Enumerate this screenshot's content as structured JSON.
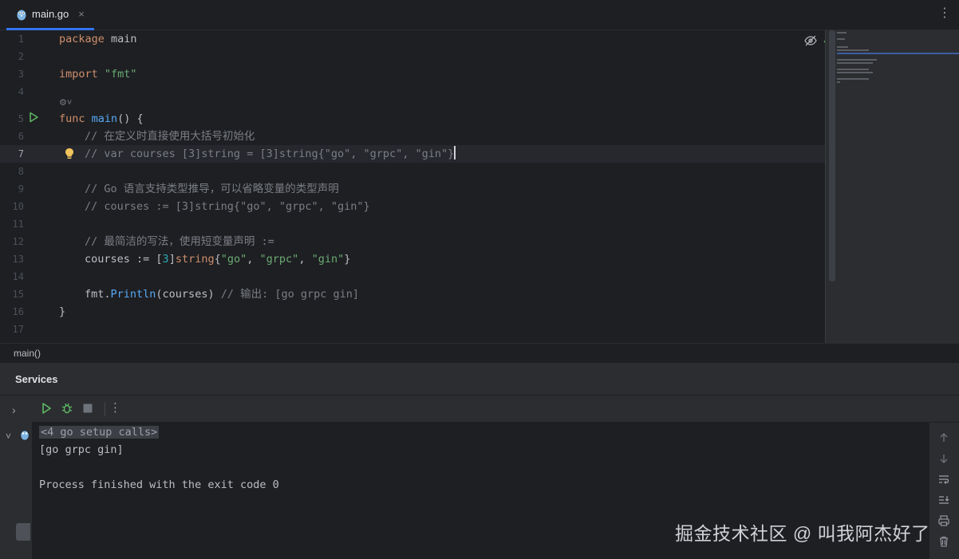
{
  "tab": {
    "label": "main.go",
    "close": "×",
    "more": "⋮"
  },
  "editor": {
    "lines": [
      {
        "n": "1"
      },
      {
        "n": "2"
      },
      {
        "n": "3"
      },
      {
        "n": "4"
      },
      {
        "n": "5"
      },
      {
        "n": "6"
      },
      {
        "n": "7"
      },
      {
        "n": "8"
      },
      {
        "n": "9"
      },
      {
        "n": "10"
      },
      {
        "n": "11"
      },
      {
        "n": "12"
      },
      {
        "n": "13"
      },
      {
        "n": "14"
      },
      {
        "n": "15"
      },
      {
        "n": "16"
      },
      {
        "n": "17"
      }
    ],
    "code": {
      "l1_kw": "package",
      "l1_rest": " main",
      "l3_kw": "import",
      "l3_str": "\"fmt\"",
      "l5_kw": "func",
      "l5_fn": "main",
      "l5_rest": "() {",
      "l6_cm": "// 在定义时直接使用大括号初始化",
      "l7_cm": "// var courses [3]string = [3]string{\"go\", \"grpc\", \"gin\"}",
      "l9_cm": "// Go 语言支持类型推导，可以省略变量的类型声明",
      "l10_cm": "// courses := [3]string{\"go\", \"grpc\", \"gin\"}",
      "l12_cm": "// 最简洁的写法，使用短变量声明 :=",
      "l13_a": "courses := [",
      "l13_num": "3",
      "l13_b": "]",
      "l13_kw": "string",
      "l13_c": "{",
      "l13_s1": "\"go\"",
      "l13_d": ", ",
      "l13_s2": "\"grpc\"",
      "l13_e": ", ",
      "l13_s3": "\"gin\"",
      "l13_f": "}",
      "l15_a": "fmt.",
      "l15_fn": "Println",
      "l15_b": "(courses) ",
      "l15_cm": "// 输出: [go grpc gin]",
      "l16": "}"
    }
  },
  "breadcrumb": "main()",
  "services": {
    "title": "Services",
    "console": {
      "fold": "<4 go setup calls>",
      "output": "[go grpc gin]",
      "finished": "Process finished with the exit code 0"
    }
  },
  "watermark": "掘金技术社区 @ 叫我阿杰好了",
  "colors": {
    "accent": "#3574f0",
    "keyword": "#cf8e6d",
    "function": "#56a8f5",
    "string": "#6aab73",
    "number": "#2aacb8",
    "comment": "#7a7e85",
    "run_green": "#5fb865"
  }
}
